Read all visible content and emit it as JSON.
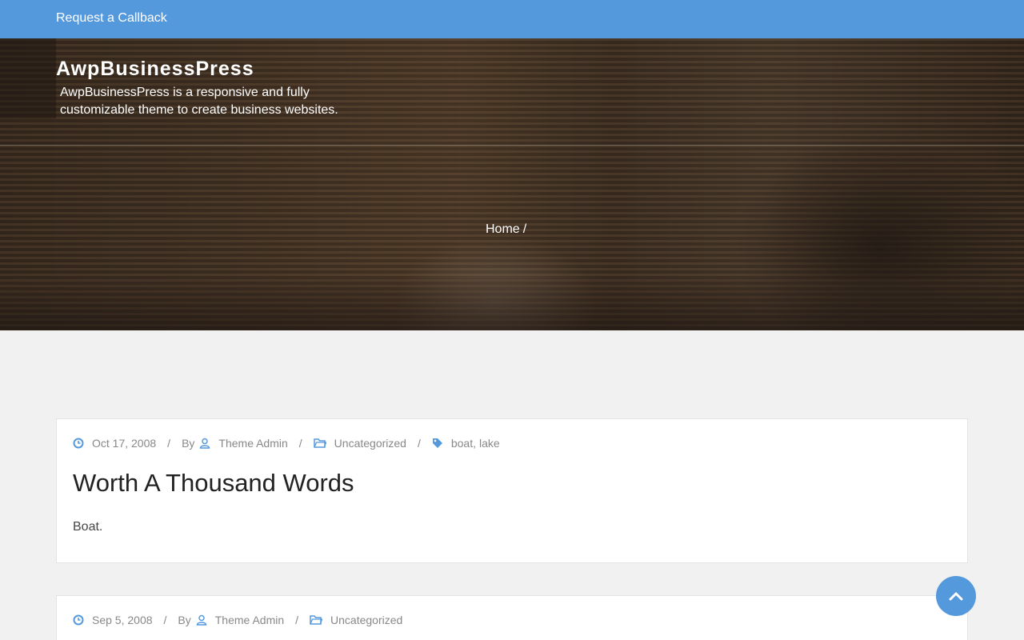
{
  "topbar": {
    "callback_label": "Request a Callback"
  },
  "header": {
    "site_title": "AwpBusinessPress",
    "site_description": "AwpBusinessPress is a responsive and fully customizable theme to create business websites."
  },
  "breadcrumb": {
    "home": "Home",
    "separator": "/"
  },
  "posts": [
    {
      "date": "Oct 17, 2008",
      "by_label": "By",
      "author": "Theme Admin",
      "category": "Uncategorized",
      "tags": [
        "boat",
        "lake"
      ],
      "title": "Worth A Thousand Words",
      "excerpt": "Boat."
    },
    {
      "date": "Sep 5, 2008",
      "by_label": "By",
      "author": "Theme Admin",
      "category": "Uncategorized"
    }
  ],
  "meta_separator": "/",
  "icons": {
    "date": "clock-icon",
    "author": "user-icon",
    "category": "folder-icon",
    "tags": "tag-icon",
    "scroll": "chevron-up-icon"
  },
  "colors": {
    "accent": "#5599dd",
    "meta_text": "#888888",
    "title_text": "#222222"
  }
}
